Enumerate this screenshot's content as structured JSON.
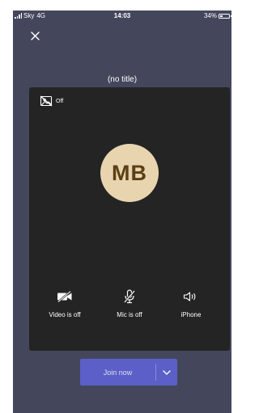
{
  "status_bar": {
    "carrier": "Sky",
    "network": "4G",
    "time": "14:03",
    "battery": "34%",
    "battery_level": 0.34
  },
  "meeting": {
    "title": "(no title)"
  },
  "preview": {
    "background_effects_label": "Off",
    "avatar_initials": "MB"
  },
  "controls": {
    "video_label": "Video is off",
    "mic_label": "Mic is off",
    "audio_label": "iPhone"
  },
  "join": {
    "label": "Join now"
  },
  "colors": {
    "background": "#44475c",
    "preview": "#242424",
    "avatar": "#e8d5b0",
    "avatar_text": "#5c3f14",
    "accent": "#5b5fc7"
  },
  "icons": {
    "close": "close-icon",
    "background_effects": "background-effects-off-icon",
    "video": "video-off-icon",
    "mic": "mic-off-icon",
    "audio": "speaker-icon",
    "join_options": "chevron-down-icon"
  }
}
